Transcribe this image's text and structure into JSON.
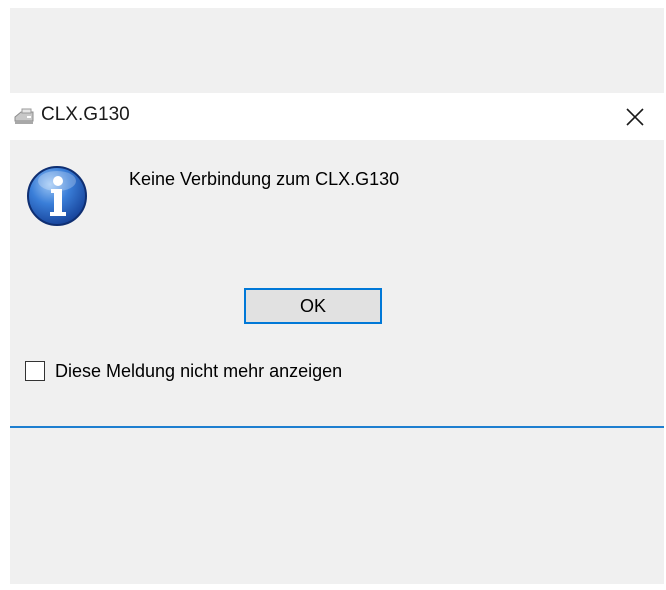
{
  "window": {
    "title": "CLX.G130",
    "app_icon": "printer-icon",
    "close_icon": "close-icon"
  },
  "dialog": {
    "icon": "info-icon",
    "message": "Keine Verbindung zum CLX.G130",
    "ok_label": "OK",
    "checkbox_label": "Diese Meldung nicht mehr anzeigen",
    "checkbox_checked": false
  },
  "colors": {
    "accent": "#0078d7",
    "dialog_bg": "#f0f0f0",
    "titlebar_bg": "#ffffff",
    "button_bg": "#e1e1e1"
  }
}
